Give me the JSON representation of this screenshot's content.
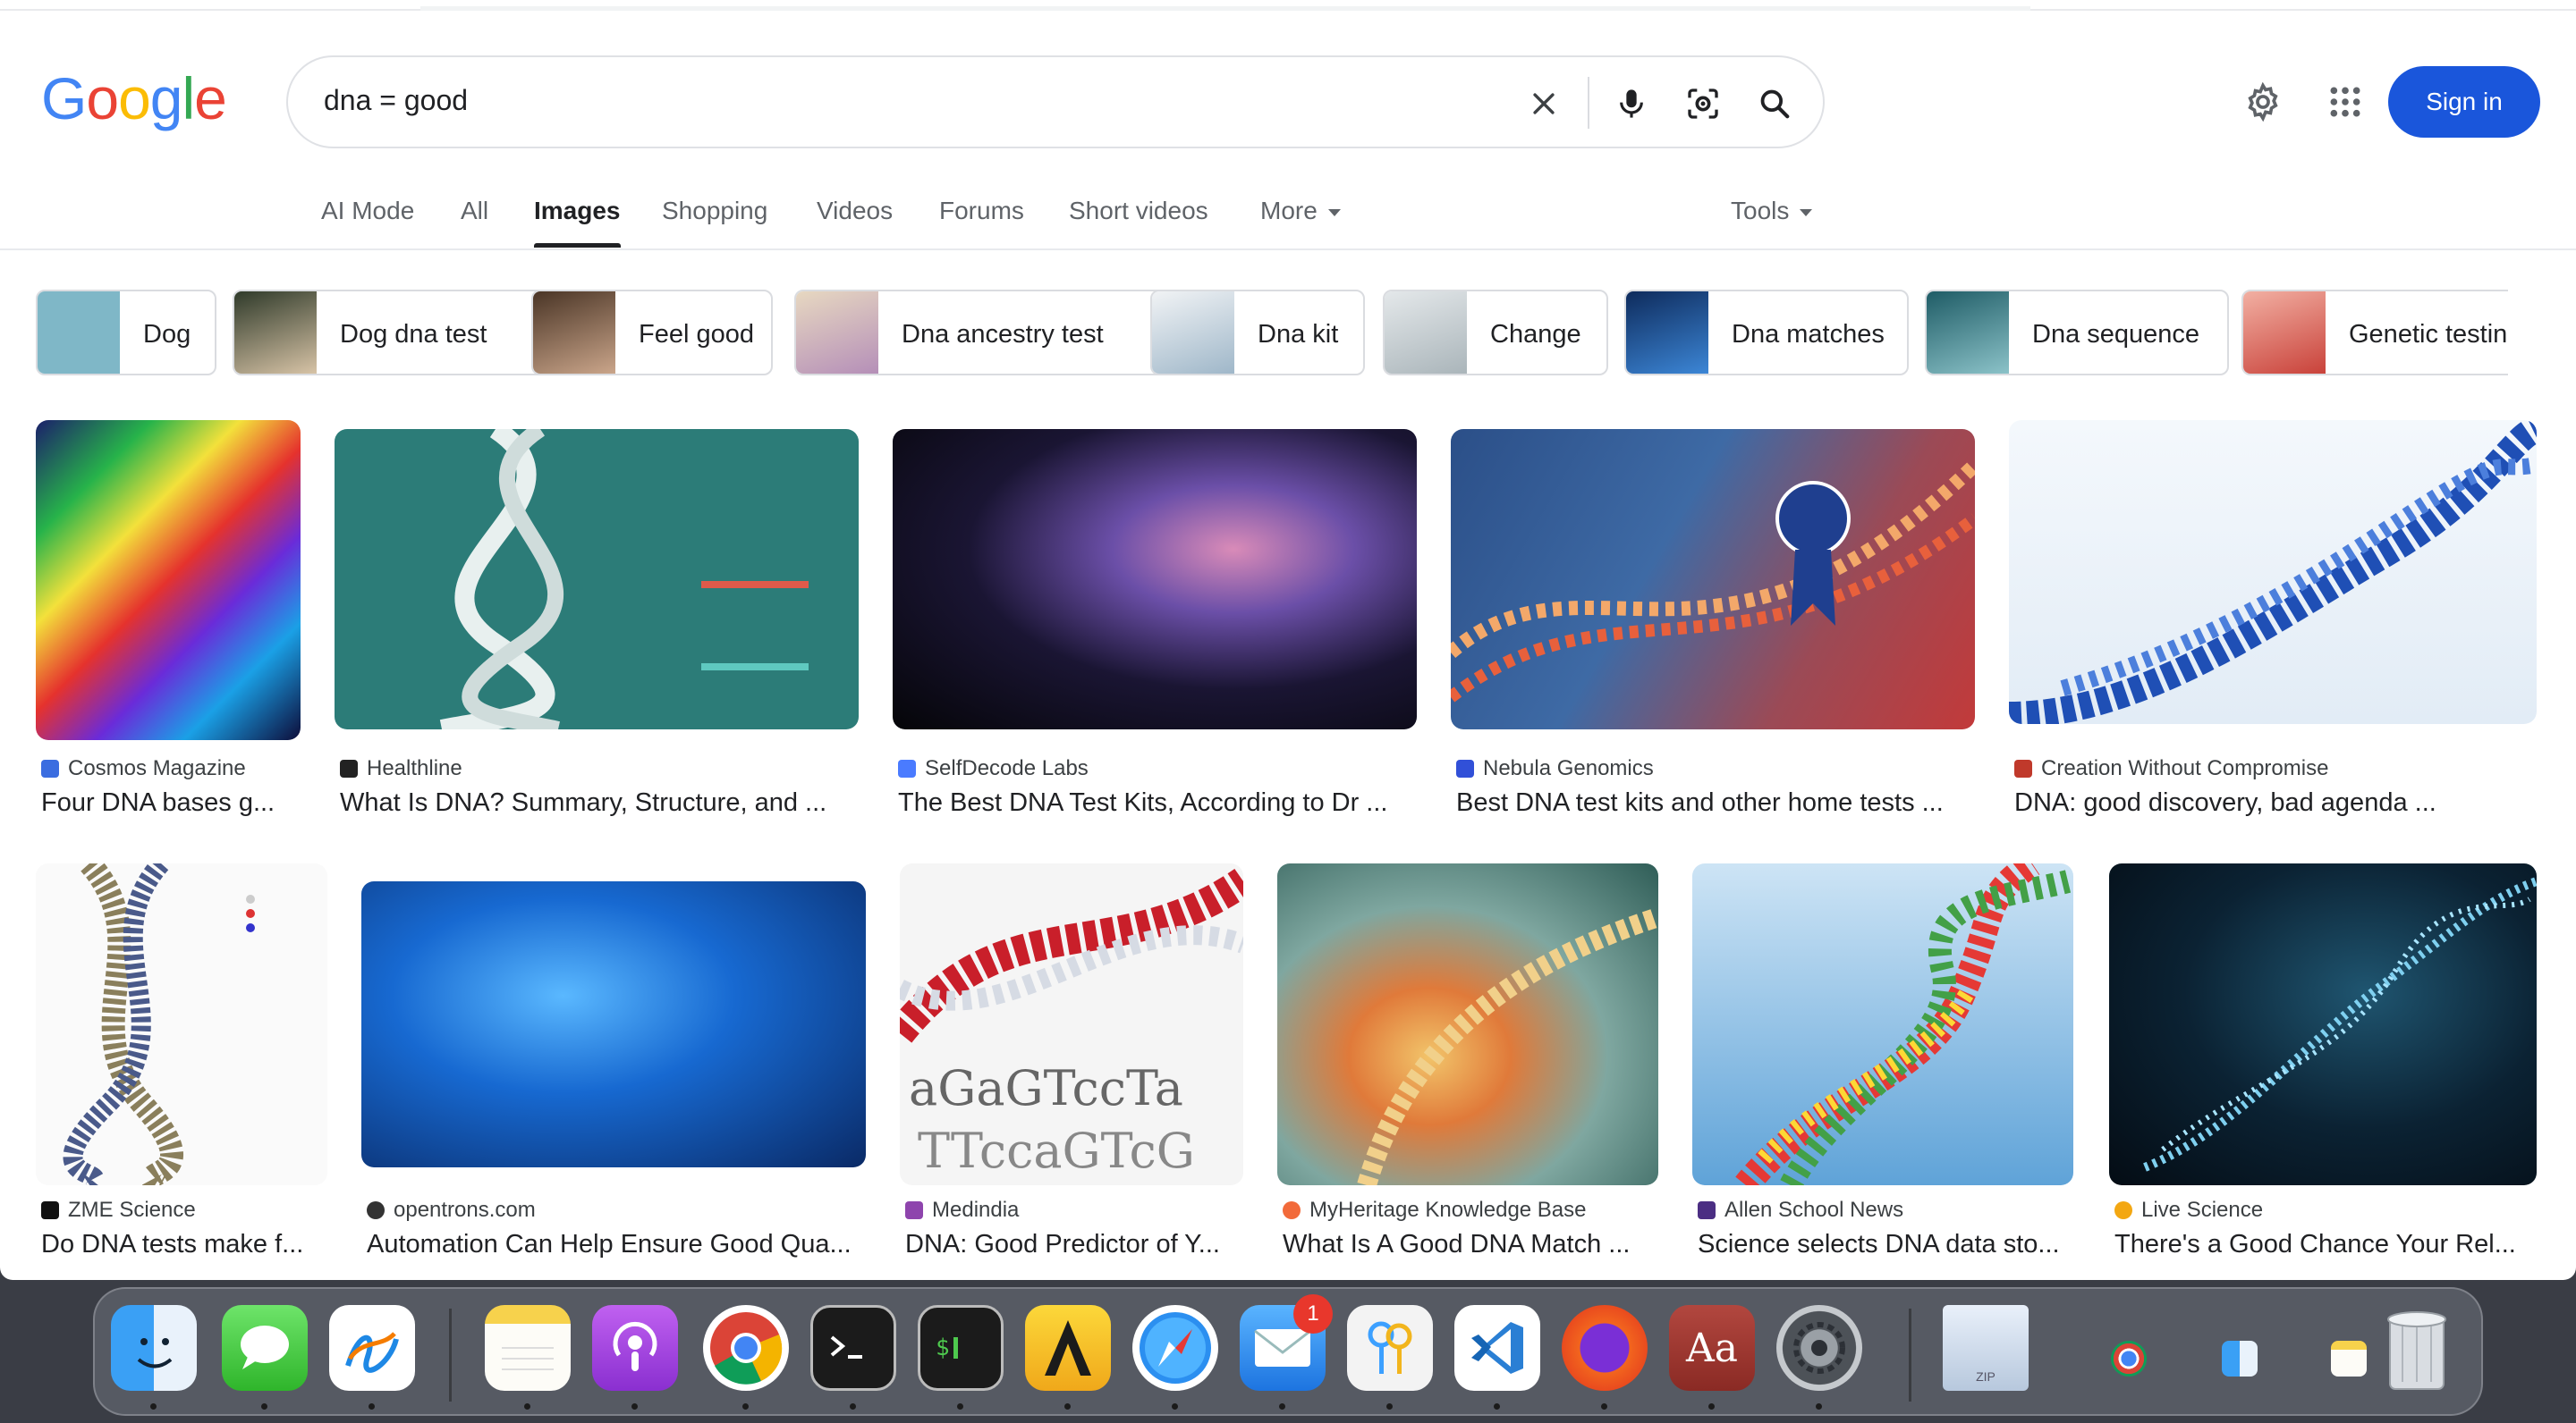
{
  "logo": [
    "G",
    "o",
    "o",
    "g",
    "l",
    "e"
  ],
  "logo_colors": [
    "#4285F4",
    "#EA4335",
    "#FBBC05",
    "#4285F4",
    "#34A853",
    "#EA4335"
  ],
  "search": {
    "query": "dna = good"
  },
  "header": {
    "sign_in": "Sign in"
  },
  "tabs": [
    {
      "label": "AI Mode"
    },
    {
      "label": "All"
    },
    {
      "label": "Images",
      "active": true
    },
    {
      "label": "Shopping"
    },
    {
      "label": "Videos"
    },
    {
      "label": "Forums"
    },
    {
      "label": "Short videos"
    },
    {
      "label": "More"
    },
    {
      "label": "Tools"
    }
  ],
  "chips": [
    {
      "label": "Dog",
      "color": "#7fb7c7"
    },
    {
      "label": "Dog dna test",
      "color": "#c9a98a"
    },
    {
      "label": "Feel good",
      "color": "#6c4b36"
    },
    {
      "label": "Dna ancestry test",
      "color": "#d8c4a6"
    },
    {
      "label": "Dna kit",
      "color": "#e8ecf0"
    },
    {
      "label": "Change",
      "color": "#cfd6da"
    },
    {
      "label": "Dna matches",
      "color": "#1e4c8f"
    },
    {
      "label": "Dna sequence",
      "color": "#2a6f7a"
    },
    {
      "label": "Genetic testin",
      "color": "#e2695f"
    }
  ],
  "results": [
    {
      "source": "Cosmos Magazine",
      "title": "Four DNA bases g...",
      "fav": "#3b6de0"
    },
    {
      "source": "Healthline",
      "title": "What Is DNA? Summary, Structure, and ...",
      "fav": "#222222"
    },
    {
      "source": "SelfDecode Labs",
      "title": "The Best DNA Test Kits, According to Dr ...",
      "fav": "#4a7bff"
    },
    {
      "source": "Nebula Genomics",
      "title": "Best DNA test kits and other home tests ...",
      "fav": "#3150d8"
    },
    {
      "source": "Creation Without Compromise",
      "title": "DNA: good discovery, bad agenda ...",
      "fav": "#c0392b"
    },
    {
      "source": "ZME Science",
      "title": "Do DNA tests make f...",
      "fav": "#111111"
    },
    {
      "source": "opentrons.com",
      "title": "Automation Can Help Ensure Good Qua...",
      "fav": "#333333"
    },
    {
      "source": "Medindia",
      "title": "DNA: Good Predictor of Y...",
      "fav": "#8e44ad"
    },
    {
      "source": "MyHeritage Knowledge Base",
      "title": "What Is A Good DNA Match ...",
      "fav": "#f26a3a"
    },
    {
      "source": "Allen School News",
      "title": "Science selects DNA data sto...",
      "fav": "#4b2e83"
    },
    {
      "source": "Live Science",
      "title": "There's a Good Chance Your Rel...",
      "fav": "#f3a712"
    }
  ],
  "dock": {
    "apps": [
      "Finder",
      "Messages",
      "Freeform",
      "Notes",
      "Podcasts",
      "Chrome",
      "Terminal",
      "Terminal 2",
      "Artstudio",
      "Safari",
      "Mail",
      "Keychain",
      "VS Code",
      "Firefox",
      "Dictionary",
      "System Settings"
    ],
    "mail_badge": "1",
    "zip_label": "ZIP",
    "dictionary_label": "Aa"
  }
}
